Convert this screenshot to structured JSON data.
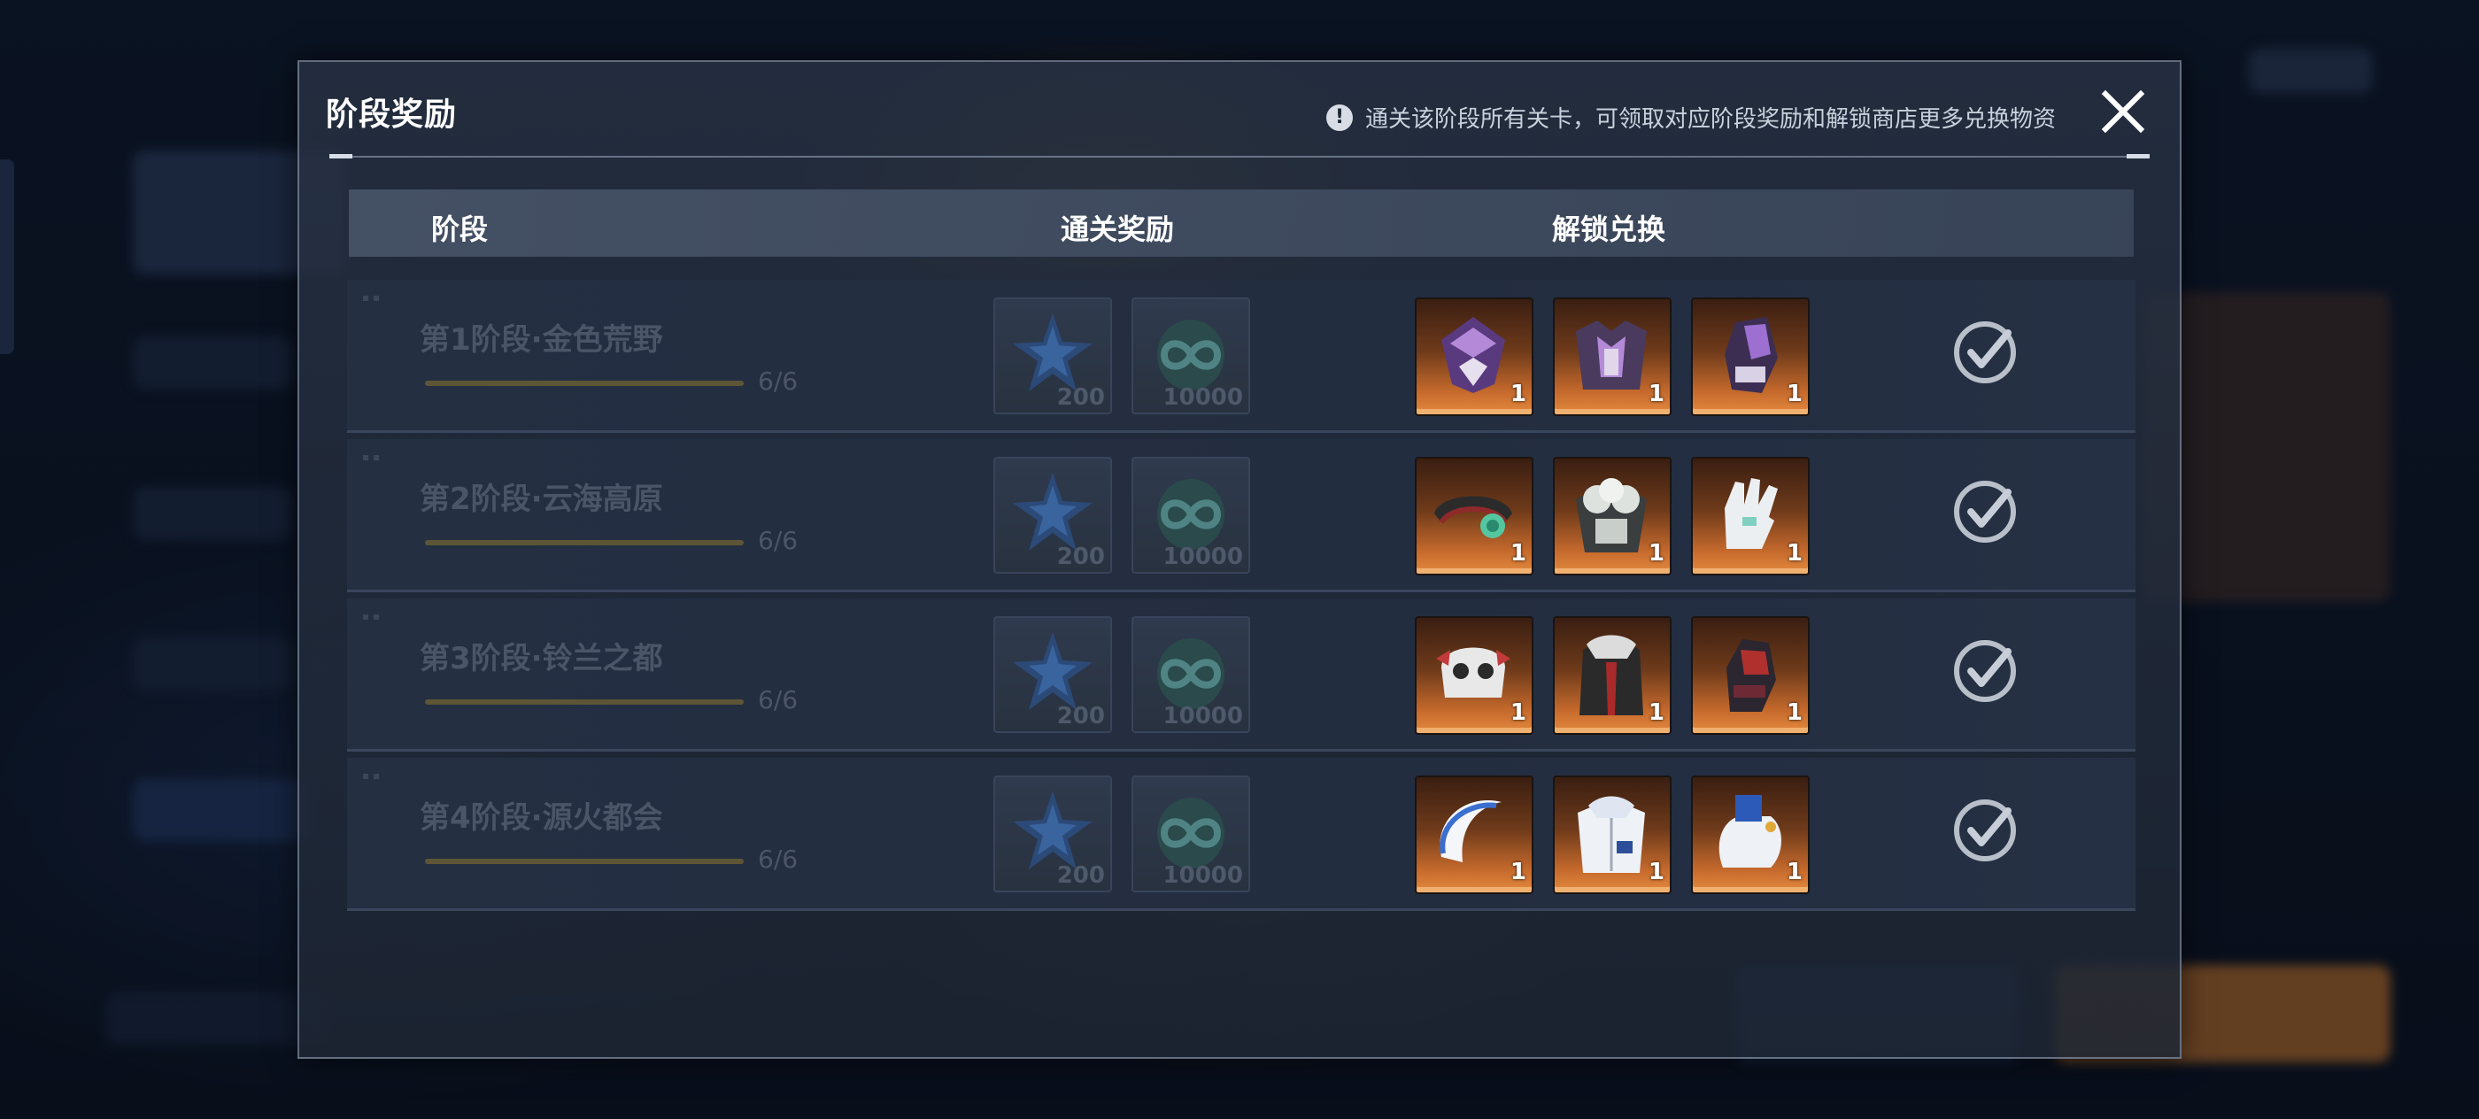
{
  "modal": {
    "title": "阶段奖励",
    "notice": "通关该阶段所有关卡，可领取对应阶段奖励和解锁商店更多兑换物资",
    "notice_icon": "exclamation-circle-icon",
    "close_icon": "close-icon"
  },
  "table": {
    "headers": {
      "stage": "阶段",
      "rewards": "通关奖励",
      "unlock": "解锁兑换"
    }
  },
  "stages": [
    {
      "name": "第1阶段·金色荒野",
      "progress_text": "6/6",
      "progress": 1.0,
      "rewards": [
        {
          "icon": "blue-star-crystal-icon",
          "qty": "200"
        },
        {
          "icon": "infinity-token-icon",
          "qty": "10000"
        }
      ],
      "items": [
        {
          "icon": "purple-helmet-icon",
          "qty": "1"
        },
        {
          "icon": "purple-armor-icon",
          "qty": "1"
        },
        {
          "icon": "purple-gauntlet-icon",
          "qty": "1"
        }
      ],
      "status_icon": "check-circle-icon"
    },
    {
      "name": "第2阶段·云海高原",
      "progress_text": "6/6",
      "progress": 1.0,
      "rewards": [
        {
          "icon": "blue-star-crystal-icon",
          "qty": "200"
        },
        {
          "icon": "infinity-token-icon",
          "qty": "10000"
        }
      ],
      "items": [
        {
          "icon": "jade-headband-icon",
          "qty": "1"
        },
        {
          "icon": "floral-armor-icon",
          "qty": "1"
        },
        {
          "icon": "white-glove-icon",
          "qty": "1"
        }
      ],
      "status_icon": "check-circle-icon"
    },
    {
      "name": "第3阶段·铃兰之都",
      "progress_text": "6/6",
      "progress": 1.0,
      "rewards": [
        {
          "icon": "blue-star-crystal-icon",
          "qty": "200"
        },
        {
          "icon": "infinity-token-icon",
          "qty": "10000"
        }
      ],
      "items": [
        {
          "icon": "skull-mask-icon",
          "qty": "1"
        },
        {
          "icon": "fur-cape-icon",
          "qty": "1"
        },
        {
          "icon": "red-gauntlet-icon",
          "qty": "1"
        }
      ],
      "status_icon": "check-circle-icon"
    },
    {
      "name": "第4阶段·源火都会",
      "progress_text": "6/6",
      "progress": 1.0,
      "rewards": [
        {
          "icon": "blue-star-crystal-icon",
          "qty": "200"
        },
        {
          "icon": "infinity-token-icon",
          "qty": "10000"
        }
      ],
      "items": [
        {
          "icon": "blue-halo-headgear-icon",
          "qty": "1"
        },
        {
          "icon": "white-coat-icon",
          "qty": "1"
        },
        {
          "icon": "blue-white-mitt-icon",
          "qty": "1"
        }
      ],
      "status_icon": "check-circle-icon"
    }
  ],
  "colors": {
    "item_bg_top": "#3a1e12",
    "item_bg_bottom": "#e58a3e",
    "completed_text": "#4a5568"
  }
}
